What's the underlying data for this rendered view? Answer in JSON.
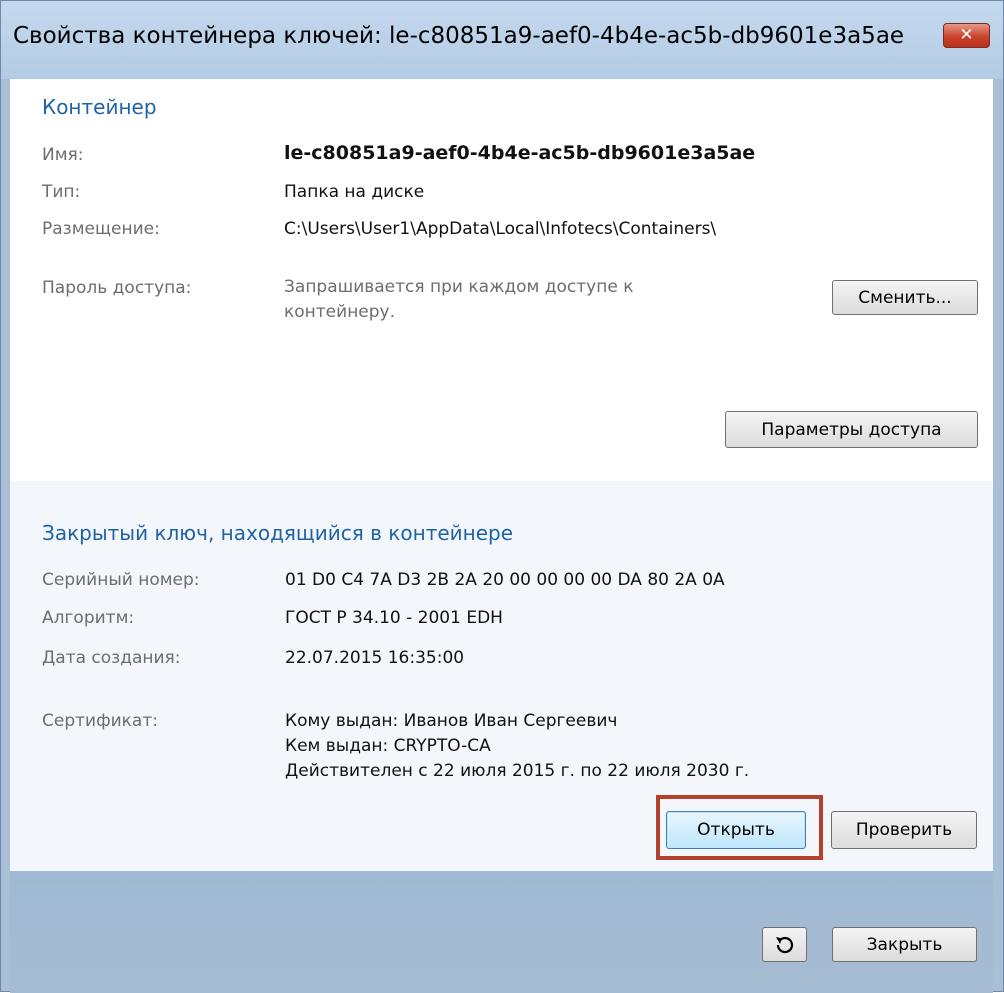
{
  "window": {
    "title": "Свойства контейнера ключей: le-c80851a9-aef0-4b4e-ac5b-db9601e3a5ae",
    "close_glyph": "✕"
  },
  "container": {
    "heading": "Контейнер",
    "name_label": "Имя:",
    "name_value": "le-c80851a9-aef0-4b4e-ac5b-db9601e3a5ae",
    "type_label": "Тип:",
    "type_value": "Папка на диске",
    "location_label": "Размещение:",
    "location_value": "C:\\Users\\User1\\AppData\\Local\\Infotecs\\Containers\\",
    "password_label": "Пароль доступа:",
    "password_value_line1": "Запрашивается при каждом доступе к",
    "password_value_line2": "контейнеру.",
    "change_button": "Сменить...",
    "access_params_button": "Параметры доступа"
  },
  "private_key": {
    "heading": "Закрытый ключ, находящийся в контейнере",
    "serial_label": "Серийный номер:",
    "serial_value": "01 D0 C4 7A D3 2B 2A 20 00 00 00 00 DA 80 2A 0A",
    "algorithm_label": "Алгоритм:",
    "algorithm_value": "ГОСТ Р 34.10 - 2001 EDH",
    "created_label": "Дата создания:",
    "created_value": "22.07.2015 16:35:00",
    "certificate_label": "Сертификат:",
    "cert_issued_to": "Кому выдан: Иванов Иван Сергеевич",
    "cert_issued_by": "Кем выдан: CRYPTO-CA",
    "cert_validity": "Действителен с 22 июля 2015 г. по 22 июля 2030 г.",
    "open_button": "Открыть",
    "verify_button": "Проверить"
  },
  "footer": {
    "refresh_icon": "refresh-icon",
    "close_button": "Закрыть"
  },
  "colors": {
    "heading": "#1f63a7",
    "highlight": "#b4412e"
  }
}
